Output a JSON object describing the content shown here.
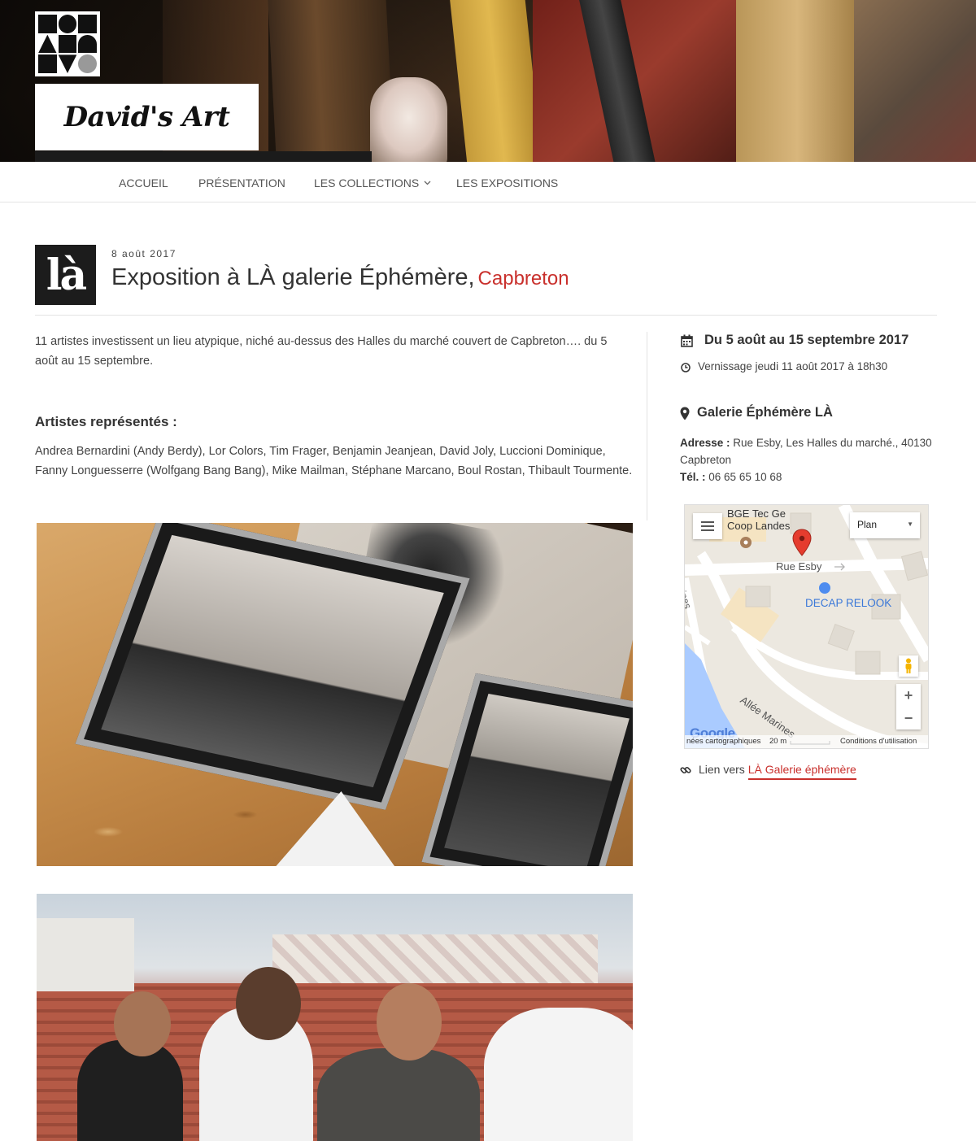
{
  "site": {
    "title": "David's Art"
  },
  "nav": {
    "items": [
      {
        "label": "ACCUEIL"
      },
      {
        "label": "PRÉSENTATION"
      },
      {
        "label": "LES COLLECTIONS",
        "has_dropdown": true
      },
      {
        "label": "LES EXPOSITIONS"
      }
    ]
  },
  "post": {
    "thumb_text": "là",
    "date": "8 août 2017",
    "title": "Exposition à LÀ galerie Éphémère,",
    "location": "Capbreton",
    "intro": "11 artistes investissent un lieu atypique, niché au-dessus des Halles du marché couvert de Capbreton…. du 5 août au 15 septembre.",
    "artists_heading": "Artistes représentés :",
    "artists": "Andrea Bernardini (Andy Berdy), Lor Colors, Tim Frager, Benjamin Jeanjean, David Joly, Luccioni Dominique, Fanny Longuesserre (Wolfgang Bang Bang), Mike Mailman, Stéphane Marcano, Boul Rostan, Thibault Tourmente."
  },
  "event": {
    "dates": "Du 5 août au 15 septembre 2017",
    "vernissage": "Vernissage jeudi 11 août 2017 à 18h30",
    "venue": "Galerie Éphémère LÀ",
    "address_label": "Adresse :",
    "address": "Rue Esby, Les Halles du marché., 40130 Capbreton",
    "phone_label": "Tél. :",
    "phone": "06 65 65 10 68",
    "link_prefix": "Lien vers",
    "link_text": "LÀ Galerie éphémère"
  },
  "map": {
    "map_type": "Plan",
    "poi_1_line1": "BGE Tec Ge",
    "poi_1_line2": "Coop Landes",
    "street_1": "Rue Esby",
    "poi_2": "DECAP RELOOK",
    "street_2": "Allée Marines",
    "street_3": "rines",
    "google": "Google",
    "data_text": "nées cartographiques",
    "scale": "20 m",
    "terms": "Conditions d'utilisation"
  },
  "colors": {
    "accent": "#c9302c",
    "text": "#333333",
    "header_dark": "#1b1b1b"
  },
  "icons": [
    "calendar-icon",
    "clock-icon",
    "map-pin-icon",
    "link-icon",
    "chevron-down-icon",
    "menu-icon",
    "pegman-icon"
  ]
}
